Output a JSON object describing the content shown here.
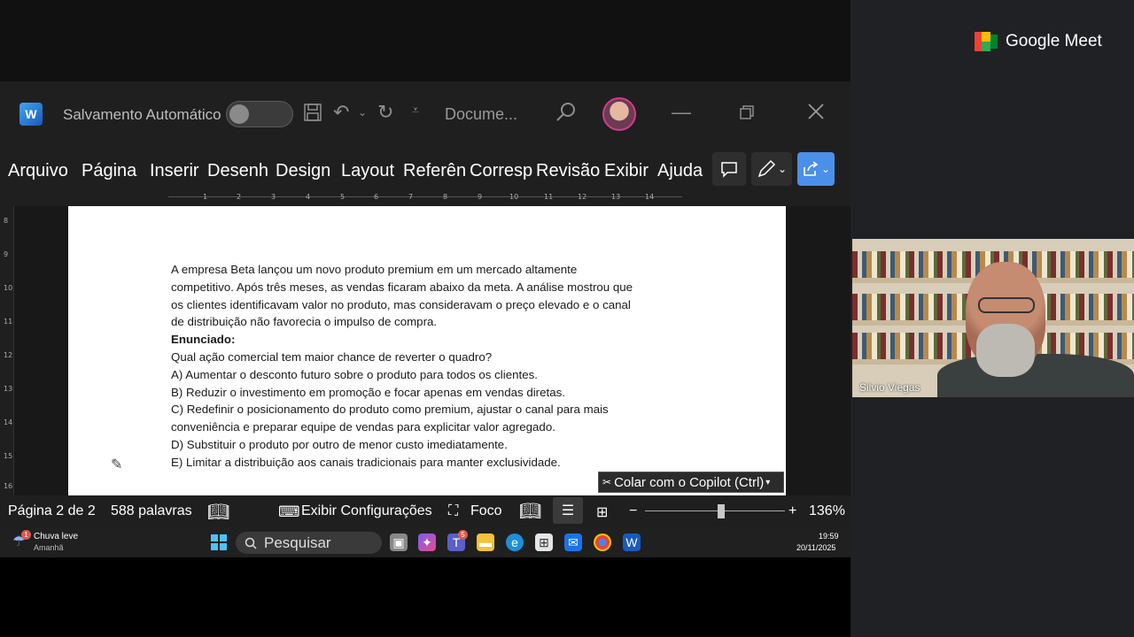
{
  "word": {
    "autosave_label": "Salvamento Automático",
    "doc_title": "Docume...",
    "tabs": [
      "Arquivo",
      "Página",
      "Inserir",
      "Desenh",
      "Design",
      "Layout",
      "Referên",
      "Corresp",
      "Revisão",
      "Exibir",
      "Ajuda"
    ],
    "ruler_numbers": [
      "1",
      "2",
      "3",
      "4",
      "5",
      "6",
      "7",
      "8",
      "9",
      "10",
      "11",
      "12",
      "13",
      "14"
    ],
    "vruler_numbers": [
      "8",
      "9",
      "10",
      "11",
      "12",
      "13",
      "14",
      "15",
      "16"
    ],
    "document": {
      "paragraph": [
        "A empresa Beta lançou um novo produto premium em um mercado altamente",
        "competitivo. Após três meses, as vendas ficaram abaixo da meta. A análise mostrou que",
        "os clientes identificavam valor no produto, mas consideravam o preço elevado e o canal",
        "de distribuição não favorecia o impulso de compra."
      ],
      "enunciado_label": "Enunciado:",
      "question": "Qual ação comercial tem maior chance de reverter o quadro?",
      "option_a": "A) Aumentar o desconto futuro sobre o produto para todos os clientes.",
      "option_b": "B) Reduzir o investimento em promoção e focar apenas em vendas diretas.",
      "option_c_1": "C) Redefinir o posicionamento do produto como premium, ajustar o canal para mais",
      "option_c_2": "conveniência e preparar equipe de vendas para explicitar valor agregado.",
      "option_d": "D) Substituir o produto por outro de menor custo imediatamente.",
      "option_e": "E) Limitar a distribuição aos canais tradicionais para manter exclusividade."
    },
    "paste_copilot": "Colar com o Copilot (Ctrl)",
    "status": {
      "page": "Página 2 de 2",
      "words": "588 palavras",
      "display_settings": "Exibir Configurações",
      "focus": "Foco",
      "zoom": "136%"
    }
  },
  "taskbar": {
    "weather_title": "Chuva leve",
    "weather_sub": "Amanhã",
    "weather_badge": "1",
    "search_placeholder": "Pesquisar",
    "teams_badge": "5",
    "time": "19:59",
    "date": "20/11/2025"
  },
  "meet": {
    "title": "Google Meet",
    "participant_name": "Silvio Viegas"
  },
  "colors": {
    "word_blue": "#185abd",
    "share_button": "#4a8fe8",
    "meet_bg": "#202124"
  },
  "icons": [
    "word-icon",
    "save-icon",
    "undo-icon",
    "redo-icon",
    "search-icon",
    "minimize-icon",
    "restore-icon",
    "close-icon",
    "comment-icon",
    "pen-icon",
    "share-icon",
    "reading-mode-icon",
    "windows-start-icon"
  ]
}
